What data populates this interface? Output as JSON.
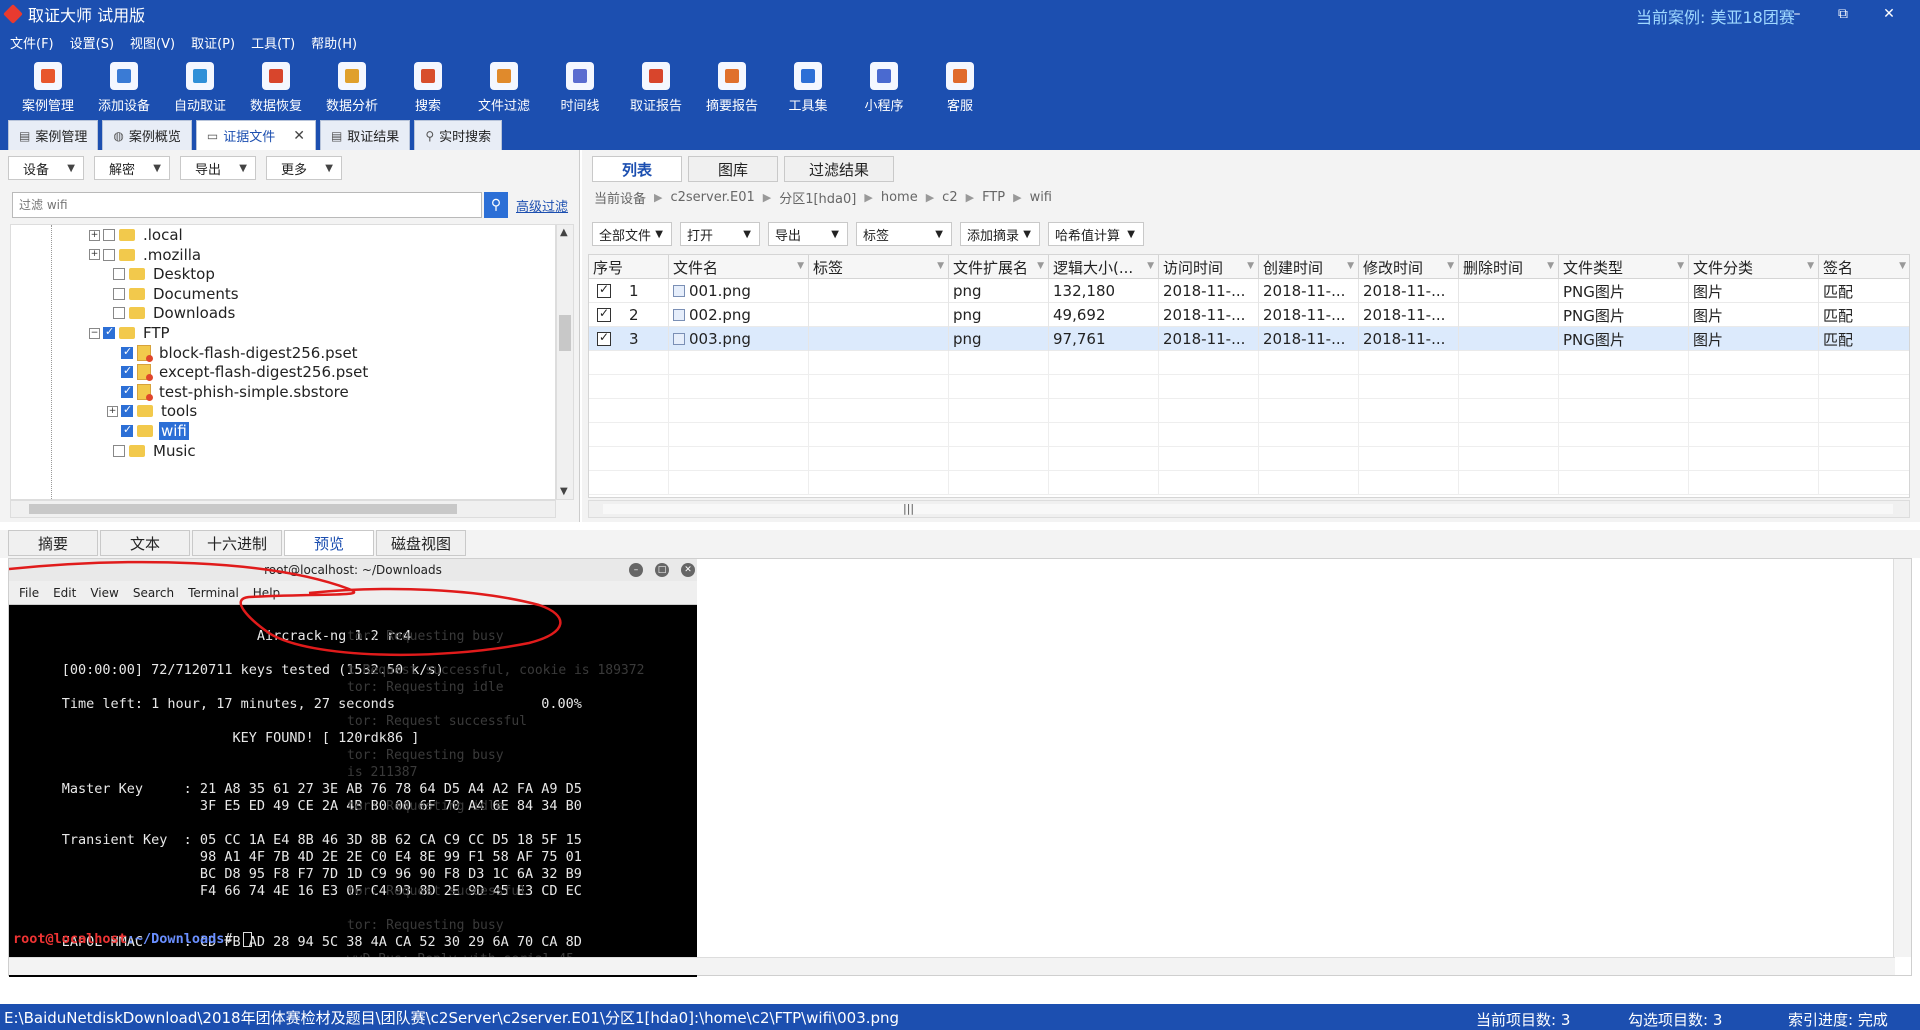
{
  "window": {
    "title": "取证大师 试用版",
    "case_label": "当前案例:  美亚18团赛",
    "controls": [
      "–",
      "⧉",
      "✕"
    ]
  },
  "menu": [
    "文件(F)",
    "设置(S)",
    "视图(V)",
    "取证(P)",
    "工具(T)",
    "帮助(H)"
  ],
  "toolbar": [
    {
      "label": "案例管理",
      "color": "#e8562c"
    },
    {
      "label": "添加设备",
      "color": "#3a7bd5"
    },
    {
      "label": "自动取证",
      "color": "#2f8fd8"
    },
    {
      "label": "数据恢复",
      "color": "#d8452c"
    },
    {
      "label": "数据分析",
      "color": "#e0a02c"
    },
    {
      "label": "搜索",
      "color": "#d84e2c"
    },
    {
      "label": "文件过滤",
      "color": "#e08a2c"
    },
    {
      "label": "时间线",
      "color": "#5a6cd0"
    },
    {
      "label": "取证报告",
      "color": "#d8452c"
    },
    {
      "label": "摘要报告",
      "color": "#e0702c"
    },
    {
      "label": "工具集",
      "color": "#2c6fd6"
    },
    {
      "label": "小程序",
      "color": "#4a6ad0"
    },
    {
      "label": "客服",
      "color": "#e06a2c"
    }
  ],
  "tabs": [
    {
      "label": "案例管理",
      "icon": "▤"
    },
    {
      "label": "案例概览",
      "icon": "◍"
    },
    {
      "label": "证据文件",
      "icon": "▭",
      "close": "✕"
    },
    {
      "label": "取证结果",
      "icon": "▤"
    },
    {
      "label": "实时搜索",
      "icon": "⚲"
    }
  ],
  "left": {
    "dropdowns": [
      "设备",
      "解密",
      "导出",
      "更多"
    ],
    "filter_placeholder": "过滤 wifi",
    "advanced_filter": "高级过滤",
    "tree": [
      {
        "label": ".local",
        "type": "folder",
        "expand": "+",
        "checked": false
      },
      {
        "label": ".mozilla",
        "type": "folder",
        "expand": "+",
        "checked": false
      },
      {
        "label": "Desktop",
        "type": "folder",
        "expand": "",
        "checked": false
      },
      {
        "label": "Documents",
        "type": "folder",
        "expand": "",
        "checked": false
      },
      {
        "label": "Downloads",
        "type": "folder",
        "expand": "",
        "checked": false
      },
      {
        "label": "FTP",
        "type": "folder",
        "expand": "−",
        "checked": true
      },
      {
        "label": "block-flash-digest256.pset",
        "type": "file",
        "expand": "",
        "checked": true
      },
      {
        "label": "except-flash-digest256.pset",
        "type": "file",
        "expand": "",
        "checked": true
      },
      {
        "label": "test-phish-simple.sbstore",
        "type": "file",
        "expand": "",
        "checked": true
      },
      {
        "label": "tools",
        "type": "folder",
        "expand": "+",
        "checked": true
      },
      {
        "label": "wifi",
        "type": "folder",
        "expand": "",
        "checked": true,
        "selected": true
      },
      {
        "label": "Music",
        "type": "folder",
        "expand": "",
        "checked": false
      }
    ]
  },
  "right": {
    "tabs": [
      "列表",
      "图库",
      "过滤结果"
    ],
    "breadcrumb": [
      "当前设备",
      "c2server.E01",
      "分区1[hda0]",
      "home",
      "c2",
      "FTP",
      "wifi"
    ],
    "dropdowns": [
      "全部文件",
      "打开",
      "导出",
      "标签",
      "添加摘录",
      "哈希值计算"
    ],
    "columns": [
      "序号",
      "文件名",
      "标签",
      "文件扩展名",
      "逻辑大小(...",
      "访问时间",
      "创建时间",
      "修改时间",
      "删除时间",
      "文件类型",
      "文件分类",
      "签名"
    ],
    "rows": [
      {
        "no": "1",
        "name": "001.png",
        "tag": "",
        "ext": "png",
        "size": "132,180",
        "atime": "2018-11-...",
        "ctime": "2018-11-...",
        "mtime": "2018-11-...",
        "dtime": "",
        "ftype": "PNG图片",
        "fclass": "图片",
        "sig": "匹配"
      },
      {
        "no": "2",
        "name": "002.png",
        "tag": "",
        "ext": "png",
        "size": "49,692",
        "atime": "2018-11-...",
        "ctime": "2018-11-...",
        "mtime": "2018-11-...",
        "dtime": "",
        "ftype": "PNG图片",
        "fclass": "图片",
        "sig": "匹配"
      },
      {
        "no": "3",
        "name": "003.png",
        "tag": "",
        "ext": "png",
        "size": "97,761",
        "atime": "2018-11-...",
        "ctime": "2018-11-...",
        "mtime": "2018-11-...",
        "dtime": "",
        "ftype": "PNG图片",
        "fclass": "图片",
        "sig": "匹配"
      }
    ]
  },
  "bottom_tabs": [
    "摘要",
    "文本",
    "十六进制",
    "预览",
    "磁盘视图"
  ],
  "terminal": {
    "title": "root@localhost: ~/Downloads",
    "menu": [
      "File",
      "Edit",
      "View",
      "Search",
      "Terminal",
      "Help"
    ],
    "lines": [
      "",
      "                              Aircrack-ng 1.2 rc4",
      "",
      "      [00:00:00] 72/7120711 keys tested (1532.50 k/s)",
      "",
      "      Time left: 1 hour, 17 minutes, 27 seconds                  0.00%",
      "",
      "                           KEY FOUND! [ 120rdk86 ]",
      "",
      "",
      "      Master Key     : 21 A8 35 61 27 3E AB 76 78 64 D5 A4 A2 FA A9 D5",
      "                       3F E5 ED 49 CE 2A 4B B0 00 6F 70 A4 6E 84 34 B0",
      "",
      "      Transient Key  : 05 CC 1A E4 8B 46 3D 8B 62 CA C9 CC D5 18 5F 15",
      "                       98 A1 4F 7B 4D 2E 2E C0 E4 8E 99 F1 58 AF 75 01",
      "                       BC D8 95 F8 F7 7D 1D C9 96 90 F8 D3 1C 6A 32 B9",
      "                       F4 66 74 4E 16 E3 0F C4 93 8D 2E 9D 45 E3 CD EC",
      "",
      "",
      "      EAPOL HMAC     : CD FB AD 28 94 5C 38 4A CA 52 30 29 6A 70 CA 8D"
    ],
    "prompt_user": "root@localhost",
    "prompt_path": ":~/Downloads",
    "prompt_suffix": "# ",
    "ghost_lines": [
      "tor: Requesting busy",
      "t Request successful, cookie is 189372",
      "tor: Requesting idle",
      "tor: Request successful",
      "tor: Requesting busy",
      "is 211387",
      "tor: Requesting idle",
      "tor: Request successful",
      "tor: Requesting busy",
      "wvD-Bus: Reply with serial 45"
    ]
  },
  "status": {
    "path": "E:\\BaiduNetdiskDownload\\2018年团体赛检材及题目\\团队赛\\c2Server\\c2server.E01\\分区1[hda0]:\\home\\c2\\FTP\\wifi\\003.png",
    "current_count": "当前项目数: 3",
    "checked_count": "勾选项目数: 3",
    "index_progress": "索引进度: 完成"
  }
}
